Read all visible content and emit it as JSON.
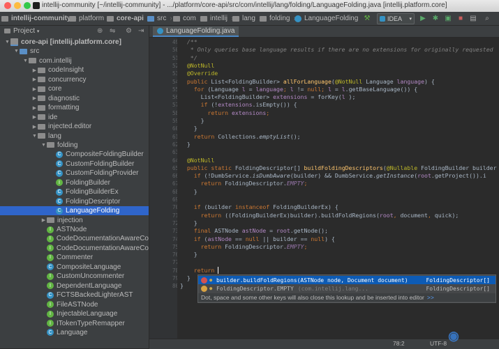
{
  "window": {
    "title": "intellij-community [~/intellij-community] - .../platform/core-api/src/com/intellij/lang/folding/LanguageFolding.java [intellij.platform.core]"
  },
  "breadcrumb": [
    "intellij-community",
    "platform",
    "core-api",
    "src",
    "com",
    "intellij",
    "lang",
    "folding",
    "LanguageFolding"
  ],
  "toolbar": {
    "run_config": "IDEA"
  },
  "project_panel": {
    "title": "Project",
    "tree": [
      {
        "label": "core-api [intellij.platform.core]",
        "kind": "module",
        "depth": 0,
        "arrow": "open",
        "bold": true
      },
      {
        "label": "src",
        "kind": "srcfolder",
        "depth": 1,
        "arrow": "open"
      },
      {
        "label": "com.intellij",
        "kind": "folder",
        "depth": 2,
        "arrow": "open"
      },
      {
        "label": "codeInsight",
        "kind": "folder",
        "depth": 3,
        "arrow": "closed"
      },
      {
        "label": "concurrency",
        "kind": "folder",
        "depth": 3,
        "arrow": "closed"
      },
      {
        "label": "core",
        "kind": "folder",
        "depth": 3,
        "arrow": "closed"
      },
      {
        "label": "diagnostic",
        "kind": "folder",
        "depth": 3,
        "arrow": "closed"
      },
      {
        "label": "formatting",
        "kind": "folder",
        "depth": 3,
        "arrow": "closed"
      },
      {
        "label": "ide",
        "kind": "folder",
        "depth": 3,
        "arrow": "closed"
      },
      {
        "label": "injected.editor",
        "kind": "folder",
        "depth": 3,
        "arrow": "closed"
      },
      {
        "label": "lang",
        "kind": "folder",
        "depth": 3,
        "arrow": "open"
      },
      {
        "label": "folding",
        "kind": "folder",
        "depth": 4,
        "arrow": "open"
      },
      {
        "label": "CompositeFoldingBuilder",
        "kind": "class",
        "depth": 5
      },
      {
        "label": "CustomFoldingBuilder",
        "kind": "class",
        "depth": 5
      },
      {
        "label": "CustomFoldingProvider",
        "kind": "class",
        "depth": 5
      },
      {
        "label": "FoldingBuilder",
        "kind": "iface",
        "depth": 5
      },
      {
        "label": "FoldingBuilderEx",
        "kind": "class",
        "depth": 5
      },
      {
        "label": "FoldingDescriptor",
        "kind": "class",
        "depth": 5
      },
      {
        "label": "LanguageFolding",
        "kind": "class",
        "depth": 5,
        "selected": true
      },
      {
        "label": "injection",
        "kind": "folder",
        "depth": 4,
        "arrow": "closed"
      },
      {
        "label": "ASTNode",
        "kind": "iface",
        "depth": 4
      },
      {
        "label": "CodeDocumentationAwareCo",
        "kind": "iface",
        "depth": 4
      },
      {
        "label": "CodeDocumentationAwareCo",
        "kind": "iface",
        "depth": 4
      },
      {
        "label": "Commenter",
        "kind": "iface",
        "depth": 4
      },
      {
        "label": "CompositeLanguage",
        "kind": "class",
        "depth": 4
      },
      {
        "label": "CustomUncommenter",
        "kind": "iface",
        "depth": 4
      },
      {
        "label": "DependentLanguage",
        "kind": "iface",
        "depth": 4
      },
      {
        "label": "FCTSBackedLighterAST",
        "kind": "class",
        "depth": 4
      },
      {
        "label": "FileASTNode",
        "kind": "iface",
        "depth": 4
      },
      {
        "label": "InjectableLanguage",
        "kind": "iface",
        "depth": 4
      },
      {
        "label": "ITokenTypeRemapper",
        "kind": "iface",
        "depth": 4
      },
      {
        "label": "Language",
        "kind": "class",
        "depth": 4
      }
    ]
  },
  "editor": {
    "tab": "LanguageFolding.java",
    "line_numbers": [
      "49",
      "50",
      "51",
      "52",
      "53",
      "54",
      "55",
      "56",
      "57",
      "58",
      "59",
      "60",
      "61",
      "62",
      "63",
      "64",
      "65",
      "66",
      "67",
      "68",
      "69",
      "70",
      "71",
      "72",
      "73",
      "74",
      "75",
      "76",
      "77",
      "78",
      "79",
      "80"
    ],
    "lines": [
      [
        [
          "cm",
          "  /**"
        ]
      ],
      [
        [
          "cm",
          "   * Only queries base language results if there are no extensions for originally requested"
        ]
      ],
      [
        [
          "cm",
          "   */"
        ]
      ],
      [
        [
          "ann",
          "  @NotNull"
        ]
      ],
      [
        [
          "ann",
          "  @Override"
        ]
      ],
      [
        [
          "kw",
          "  public "
        ],
        [
          "",
          "List<FoldingBuilder> "
        ],
        [
          "mt",
          "allForLanguage"
        ],
        [
          "",
          "("
        ],
        [
          "ann",
          "@NotNull "
        ],
        [
          "",
          "Language "
        ],
        [
          "prm",
          "language"
        ],
        [
          "",
          ") {"
        ]
      ],
      [
        [
          "kw",
          "    for "
        ],
        [
          "",
          "(Language "
        ],
        [
          "prm",
          "l"
        ],
        [
          "",
          " = "
        ],
        [
          "prm",
          "language"
        ],
        [
          "kw",
          "; "
        ],
        [
          "prm",
          "l"
        ],
        [
          "",
          " != "
        ],
        [
          "kw",
          "null"
        ],
        [
          "kw",
          "; "
        ],
        [
          "prm",
          "l"
        ],
        [
          "",
          " = "
        ],
        [
          "prm",
          "l"
        ],
        [
          "",
          ".getBaseLanguage()) {"
        ]
      ],
      [
        [
          "",
          "      List<FoldingBuilder> "
        ],
        [
          "prm",
          "extensions"
        ],
        [
          "",
          " = forKey("
        ],
        [
          "prm",
          "l"
        ],
        [
          "",
          " );"
        ]
      ],
      [
        [
          "kw",
          "      if "
        ],
        [
          "",
          "(!"
        ],
        [
          "prm",
          "extensions"
        ],
        [
          "",
          ".isEmpty()) {"
        ]
      ],
      [
        [
          "kw",
          "        return "
        ],
        [
          "prm",
          "extensions"
        ],
        [
          "kw",
          ";"
        ]
      ],
      [
        [
          "",
          "      }"
        ]
      ],
      [
        [
          "",
          "    }"
        ]
      ],
      [
        [
          "kw",
          "    return "
        ],
        [
          "",
          "Collections."
        ],
        [
          "it",
          "emptyList"
        ],
        [
          "",
          "();"
        ]
      ],
      [
        [
          "",
          "  }"
        ]
      ],
      [
        [
          "",
          ""
        ]
      ],
      [
        [
          "ann",
          "  @NotNull"
        ]
      ],
      [
        [
          "kw",
          "  public static "
        ],
        [
          "",
          "FoldingDescriptor[] "
        ],
        [
          "mt",
          "buildFoldingDescriptors"
        ],
        [
          "",
          "("
        ],
        [
          "ann",
          "@Nullable "
        ],
        [
          "",
          "FoldingBuilder builder"
        ]
      ],
      [
        [
          "kw",
          "    if "
        ],
        [
          "",
          "(!DumbService."
        ],
        [
          "it",
          "isDumbAware"
        ],
        [
          "",
          "(builder) && DumbService."
        ],
        [
          "it",
          "getInstance"
        ],
        [
          "",
          "("
        ],
        [
          "prm",
          "root"
        ],
        [
          "",
          ".getProject()).i"
        ]
      ],
      [
        [
          "kw",
          "      return "
        ],
        [
          "",
          "FoldingDescriptor."
        ],
        [
          "st",
          "EMPTY"
        ],
        [
          "kw",
          ";"
        ]
      ],
      [
        [
          "",
          "    }"
        ]
      ],
      [
        [
          "",
          ""
        ]
      ],
      [
        [
          "kw",
          "    if "
        ],
        [
          "",
          "(builder "
        ],
        [
          "kw",
          "instanceof "
        ],
        [
          "",
          "FoldingBuilderEx) {"
        ]
      ],
      [
        [
          "kw",
          "      return "
        ],
        [
          "",
          "((FoldingBuilderEx)builder).buildFoldRegions("
        ],
        [
          "prm",
          "root"
        ],
        [
          "kw",
          ", "
        ],
        [
          "",
          "document"
        ],
        [
          "kw",
          ", "
        ],
        [
          "",
          "quick);"
        ]
      ],
      [
        [
          "",
          "    }"
        ]
      ],
      [
        [
          "kw",
          "    final "
        ],
        [
          "",
          "ASTNode "
        ],
        [
          "prm",
          "astNode"
        ],
        [
          "",
          " = "
        ],
        [
          "prm",
          "root"
        ],
        [
          "",
          ".getNode();"
        ]
      ],
      [
        [
          "kw",
          "    if "
        ],
        [
          "",
          "("
        ],
        [
          "prm",
          "astNode"
        ],
        [
          "",
          " == "
        ],
        [
          "kw",
          "null "
        ],
        [
          "",
          "|| builder == "
        ],
        [
          "kw",
          "null"
        ],
        [
          "",
          ") {"
        ]
      ],
      [
        [
          "kw",
          "      return "
        ],
        [
          "",
          "FoldingDescriptor."
        ],
        [
          "st",
          "EMPTY"
        ],
        [
          "kw",
          ";"
        ]
      ],
      [
        [
          "",
          "    }"
        ]
      ],
      [
        [
          "",
          ""
        ]
      ],
      [
        [
          "kw",
          "    return "
        ],
        [
          "caret",
          ""
        ]
      ],
      [
        [
          "",
          "  }"
        ]
      ],
      [
        [
          "",
          "}"
        ]
      ]
    ]
  },
  "completion": {
    "items": [
      {
        "text": "builder.buildFoldRegions(ASTNode node, Document document)",
        "type": "FoldingDescriptor[]",
        "selected": true
      },
      {
        "text": "FoldingDescriptor.EMPTY",
        "detail": "(com.intellij.lang...",
        "type": "FoldingDescriptor[]",
        "selected": false
      }
    ],
    "hint": "Dot, space and some other keys will also close this lookup and be inserted into editor",
    "hint_link": ">>"
  },
  "status": {
    "position": "78:2",
    "encoding": "UTF-8"
  },
  "colors": {
    "selection": "#2f65ca",
    "popup_selection": "#0d5bb5",
    "background": "#2b2b2b"
  }
}
